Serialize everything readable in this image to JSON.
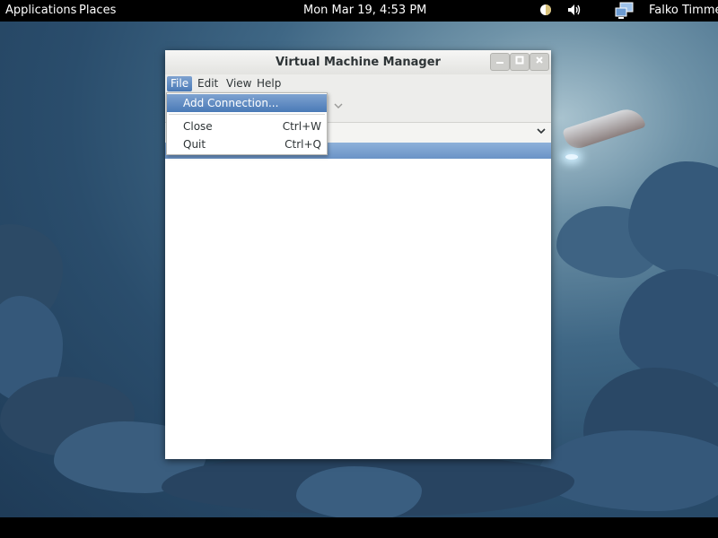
{
  "topbar": {
    "applications": "Applications",
    "places": "Places",
    "clock": "Mon Mar 19,  4:53 PM",
    "user": "Falko Timme",
    "icons": [
      "night-light-icon",
      "volume-icon",
      "network-icon"
    ]
  },
  "window": {
    "title": "Virtual Machine Manager",
    "buttons": [
      "minimize",
      "maximize",
      "close"
    ]
  },
  "menubar": {
    "file": "File",
    "edit": "Edit",
    "view": "View",
    "help": "Help"
  },
  "file_menu": {
    "items": [
      {
        "label": "Add Connection...",
        "accel": ""
      },
      {
        "label": "Close",
        "accel": "Ctrl+W"
      },
      {
        "label": "Quit",
        "accel": "Ctrl+Q"
      }
    ]
  },
  "colors": {
    "selection": "#5a86c0",
    "topbar": "#000000"
  }
}
